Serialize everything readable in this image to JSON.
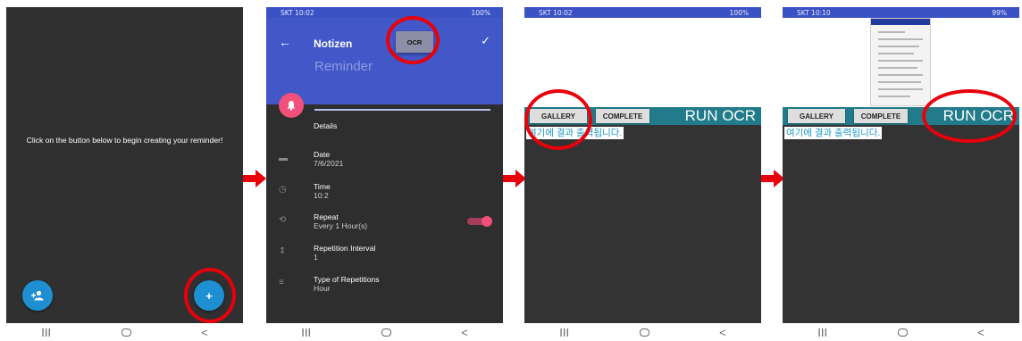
{
  "colors": {
    "header_blue": "#4257c8",
    "status_blue": "#3a52c4",
    "teal_toolbar": "#227b8a",
    "fab_blue": "#1e90d2",
    "accent_pink": "#f0507a",
    "highlight_ring": "#e8000b",
    "arrow_red": "#e8000b"
  },
  "phone1": {
    "hint": "Click on the button below to begin creating your reminder!",
    "fab_left_icon": "add-person-icon",
    "fab_right_label": "+",
    "nav": {
      "recent": "III",
      "back": "<"
    }
  },
  "phone2": {
    "status": {
      "left": "SKT 10:02",
      "right": "100%"
    },
    "header": {
      "back": "←",
      "title": "Notizen",
      "ocr_button": "OCR",
      "check": "✓"
    },
    "reminder_placeholder": "Reminder",
    "details_label": "Details",
    "rows": [
      {
        "icon": "calendar-icon",
        "title": "Date",
        "value": "7/6/2021"
      },
      {
        "icon": "clock-icon",
        "title": "Time",
        "value": "10:2"
      },
      {
        "icon": "repeat-icon",
        "title": "Repeat",
        "value": "Every 1 Hour(s)",
        "toggle": true
      },
      {
        "icon": "interval-icon",
        "title": "Repetition Interval",
        "value": "1"
      },
      {
        "icon": "list-icon",
        "title": "Type of Repetitions",
        "value": "Hour"
      }
    ],
    "nav": {
      "recent": "III",
      "back": "<"
    }
  },
  "phone3": {
    "status": {
      "left": "SKT 10:02",
      "right": "100%"
    },
    "gallery": "GALLERY",
    "complete": "COMPLETE",
    "run_ocr": "RUN OCR",
    "result_text": "여기에 결과 출력됩니다.",
    "nav": {
      "recent": "III",
      "back": "<"
    }
  },
  "phone4": {
    "status": {
      "left": "SKT 10:10",
      "right": "99%"
    },
    "gallery": "GALLERY",
    "complete": "COMPLETE",
    "run_ocr": "RUN OCR",
    "result_text": "여기에 결과 출력됩니다.",
    "nav": {
      "recent": "III",
      "back": "<"
    }
  }
}
